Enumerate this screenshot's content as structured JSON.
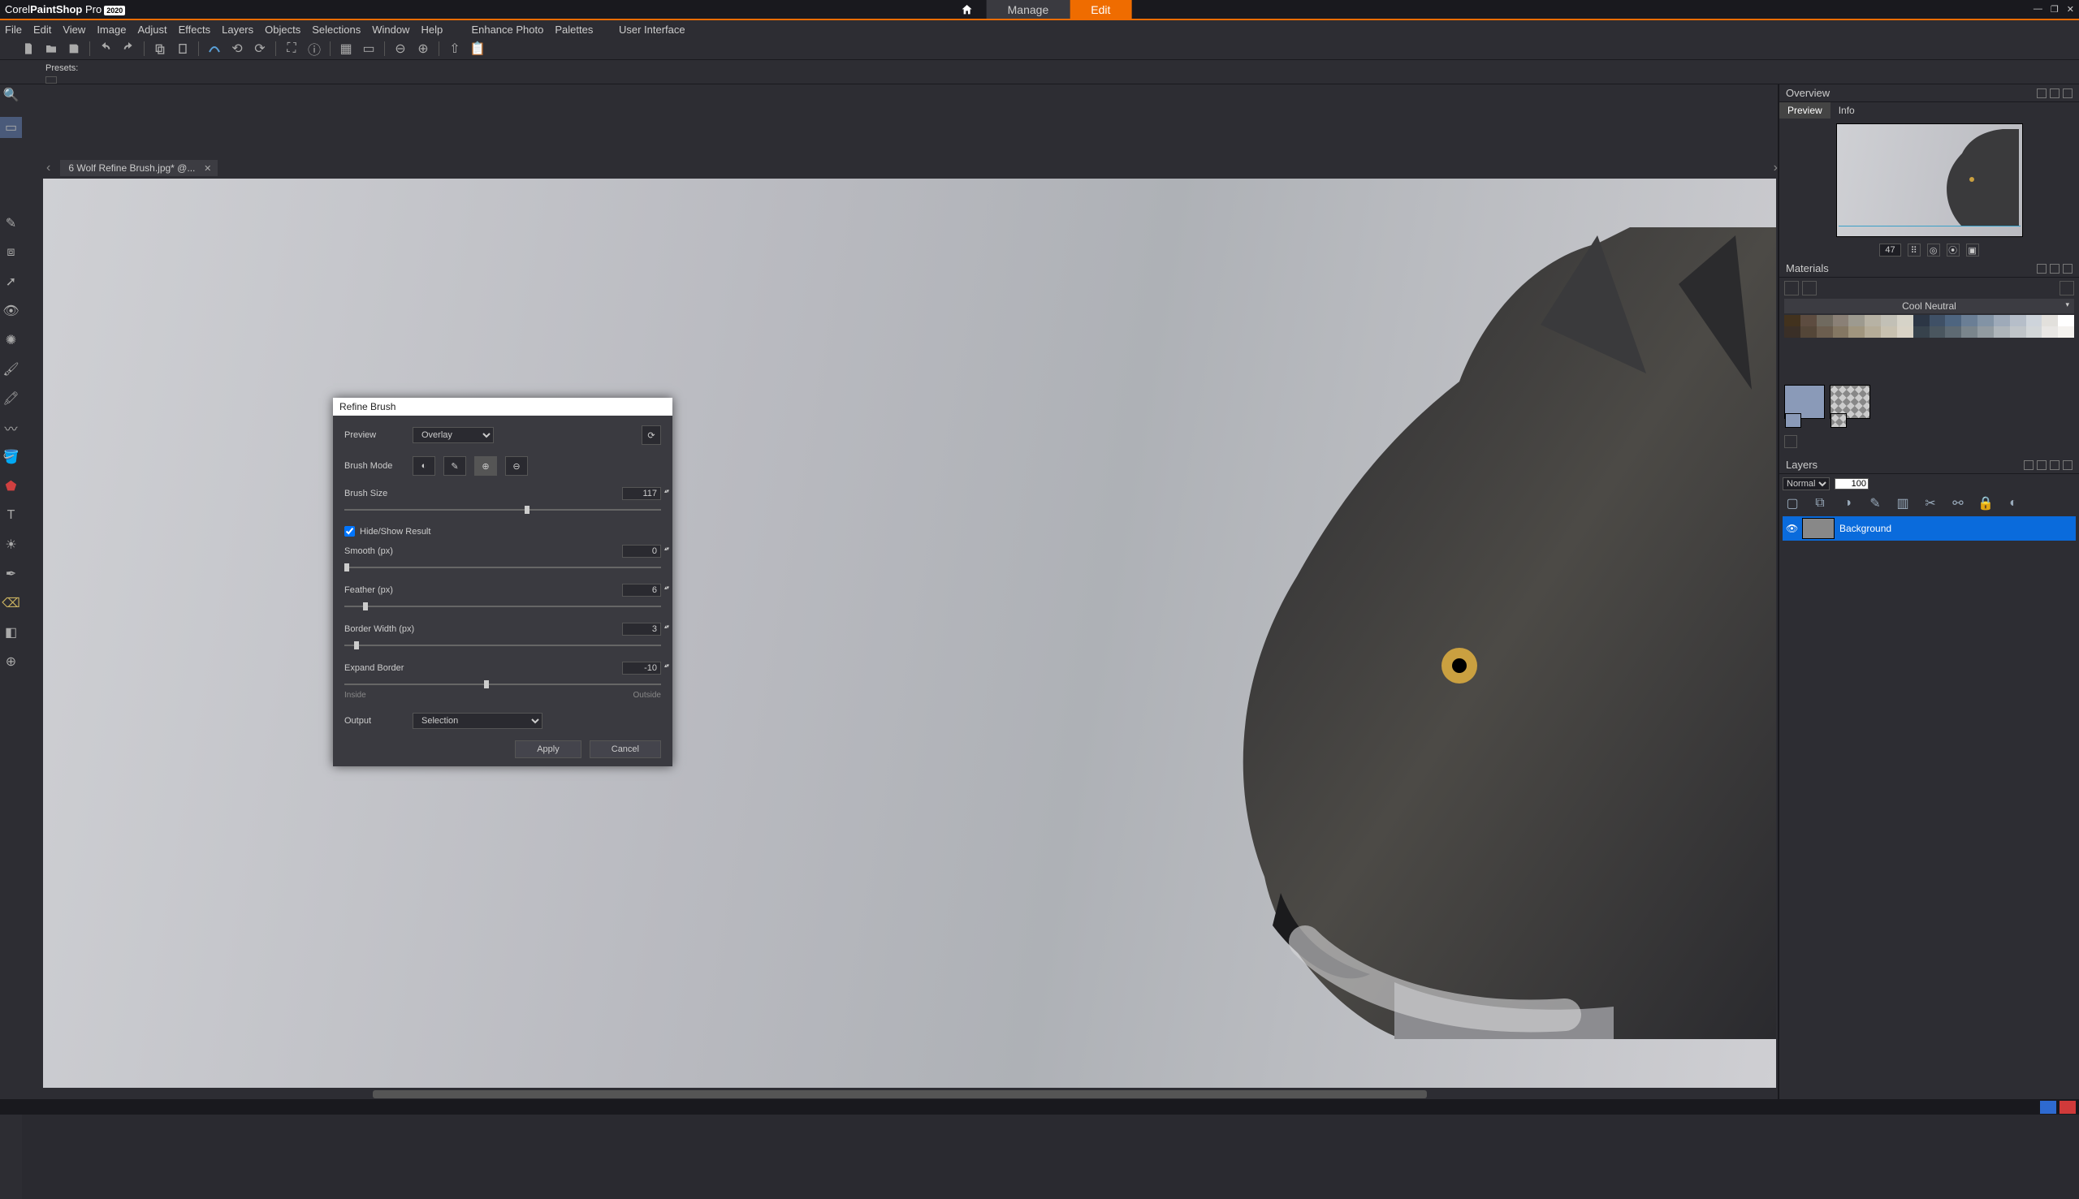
{
  "app": {
    "brand_light": "Corel",
    "brand_bold": "PaintShop",
    "brand_suffix": "Pro",
    "brand_year": "2020"
  },
  "header_tabs": {
    "manage": "Manage",
    "edit": "Edit"
  },
  "menu": {
    "file": "File",
    "edit": "Edit",
    "view": "View",
    "image": "Image",
    "adjust": "Adjust",
    "effects": "Effects",
    "layers": "Layers",
    "objects": "Objects",
    "selections": "Selections",
    "window": "Window",
    "help": "Help",
    "enhance": "Enhance Photo",
    "palettes": "Palettes",
    "ui": "User Interface"
  },
  "presets_label": "Presets:",
  "document": {
    "tab": "6 Wolf Refine Brush.jpg* @..."
  },
  "overview": {
    "title": "Overview",
    "tabs": {
      "preview": "Preview",
      "info": "Info"
    },
    "zoom": "47"
  },
  "materials": {
    "title": "Materials",
    "palette": "Cool Neutral",
    "swatches": [
      "#42321e",
      "#5d4c40",
      "#706a5f",
      "#8a8076",
      "#9d9a8f",
      "#b7b2a4",
      "#c2c0b6",
      "#d6d3c8",
      "#2c3645",
      "#3f5066",
      "#4e6580",
      "#6a7e95",
      "#8293a5",
      "#9eaab9",
      "#b6bec9",
      "#ced4db",
      "#e2e0dc",
      "#ffffff",
      "#3a2f27",
      "#544638",
      "#6c5e4f",
      "#847763",
      "#a0957e",
      "#b5ac98",
      "#c8c1b0",
      "#d9d3c6",
      "#37424c",
      "#4a565f",
      "#5e6a73",
      "#7a858c",
      "#929ba1",
      "#aeb5ba",
      "#c0c5c9",
      "#d2d6d8",
      "#e8e6e4",
      "#f4f2ef"
    ],
    "fg": "#8a9ab8",
    "bg": "#e6e6e6"
  },
  "layers": {
    "title": "Layers",
    "blend": "Normal",
    "opacity": "100",
    "entry": "Background"
  },
  "dialog": {
    "title": "Refine Brush",
    "preview_lbl": "Preview",
    "preview_val": "Overlay",
    "brush_mode_lbl": "Brush Mode",
    "brush_size_lbl": "Brush Size",
    "brush_size_val": "117",
    "hide_show": "Hide/Show Result",
    "smooth_lbl": "Smooth (px)",
    "smooth_val": "0",
    "feather_lbl": "Feather (px)",
    "feather_val": "6",
    "border_lbl": "Border Width (px)",
    "border_val": "3",
    "expand_lbl": "Expand Border",
    "expand_val": "-10",
    "inside": "Inside",
    "outside": "Outside",
    "output_lbl": "Output",
    "output_val": "Selection",
    "apply": "Apply",
    "cancel": "Cancel"
  }
}
